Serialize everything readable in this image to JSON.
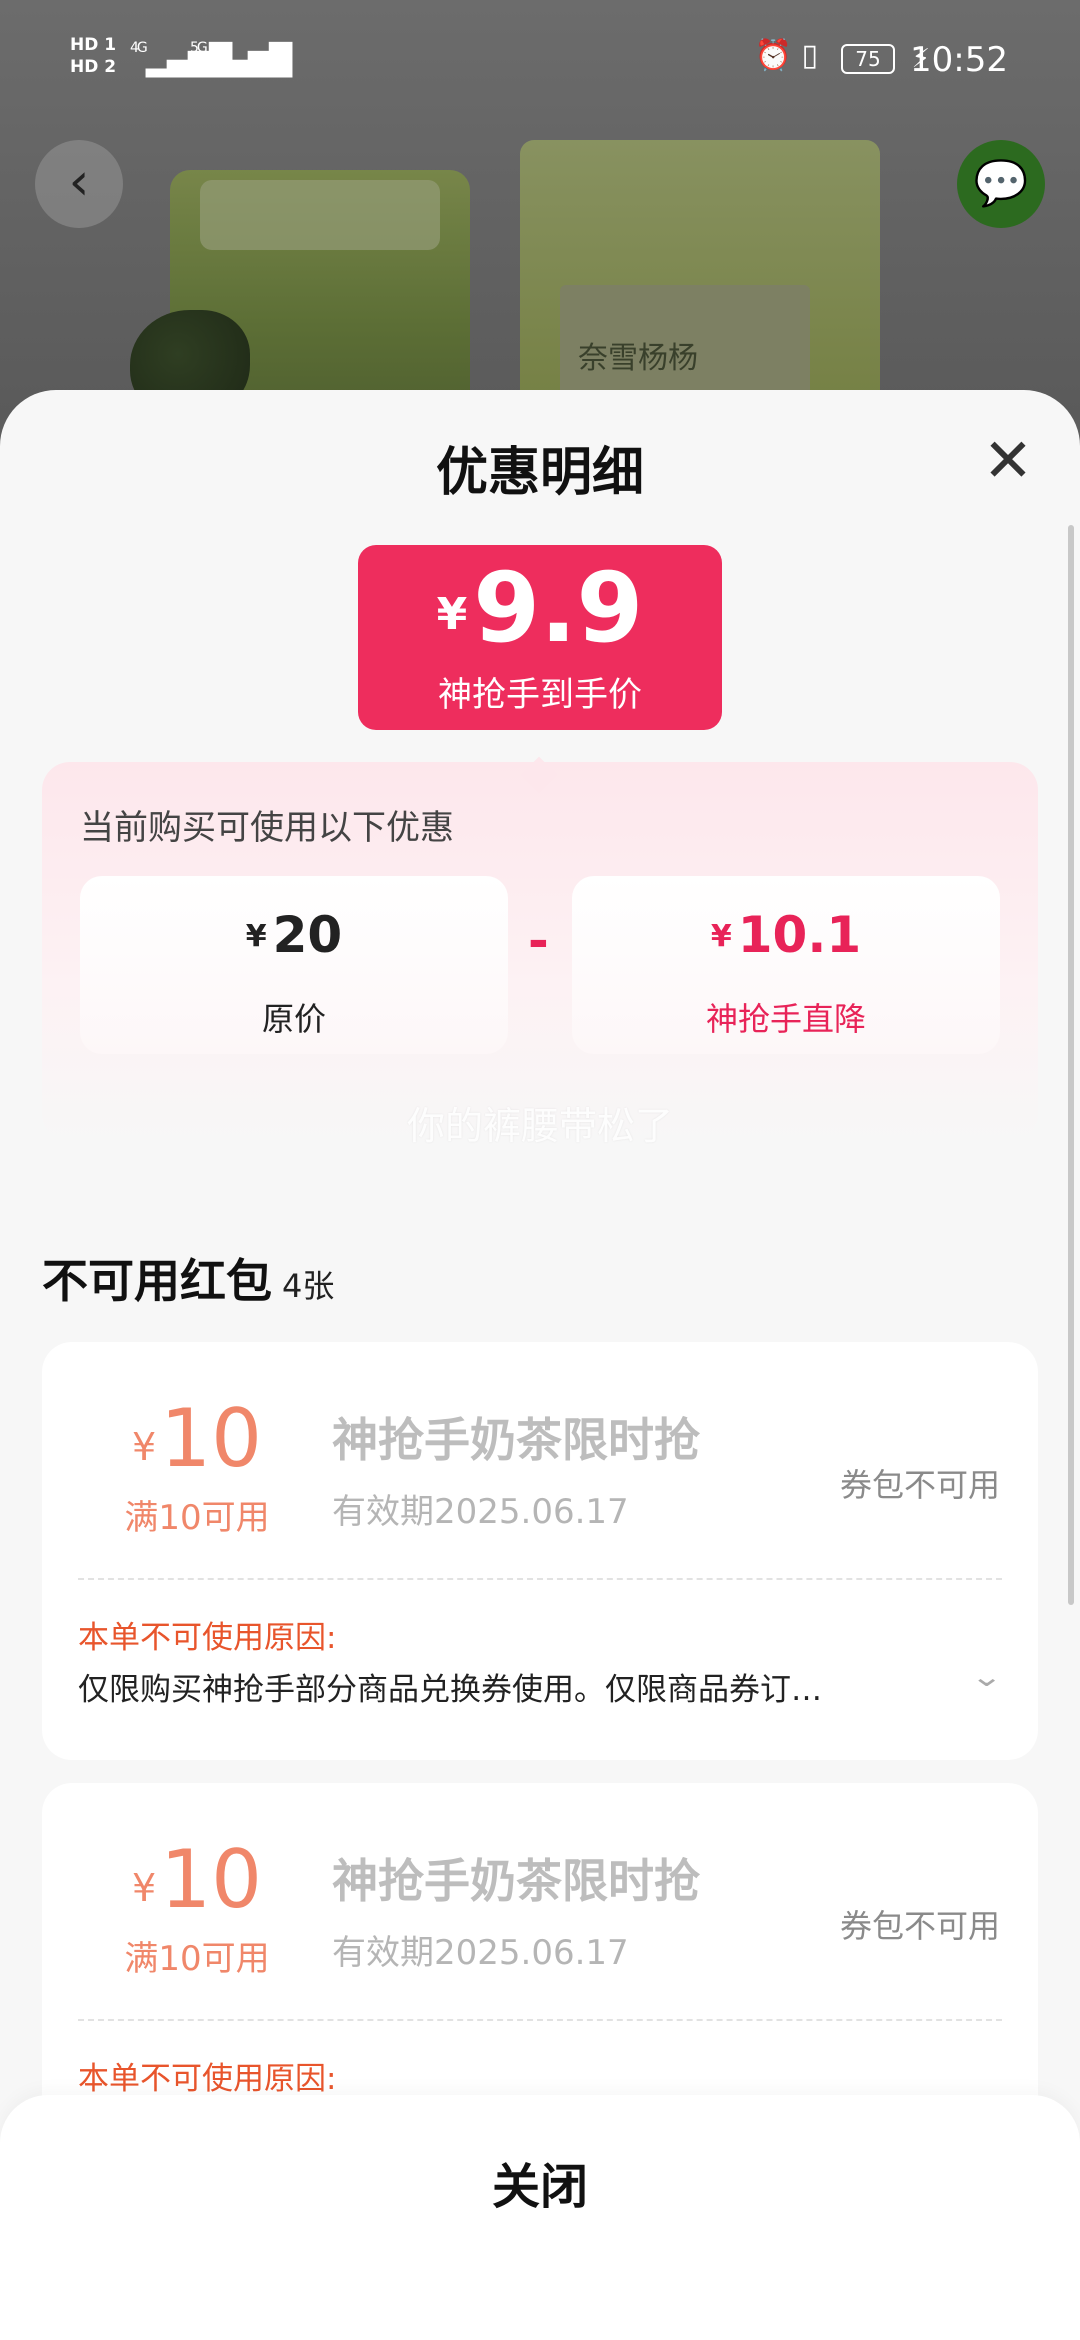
{
  "status_bar": {
    "sim1": "HD 1",
    "sim2": "HD 2",
    "net1": "4G",
    "net2": "5G",
    "battery": "75",
    "time": "10:52"
  },
  "background": {
    "product_label": "奈雪杨杨"
  },
  "sheet": {
    "title": "优惠明细",
    "final_price": {
      "currency": "¥",
      "value": "9.9",
      "label": "神抢手到手价"
    },
    "discount": {
      "header": "当前购买可使用以下优惠",
      "original": {
        "currency": "¥",
        "value": "20",
        "label": "原价"
      },
      "operator": "-",
      "cut": {
        "currency": "¥",
        "value": "10.1",
        "label": "神抢手直降"
      }
    },
    "watermark": "你的裤腰带松了",
    "unavailable": {
      "title": "不可用红包",
      "count": "4张",
      "coupons": [
        {
          "currency": "¥",
          "amount": "10",
          "condition": "满10可用",
          "name": "神抢手奶茶限时抢",
          "expiry": "有效期2025.06.17",
          "state": "券包不可用",
          "reason_header": "本单不可使用原因:",
          "reason": "仅限购买神抢手部分商品兑换券使用。仅限商品券订…"
        },
        {
          "currency": "¥",
          "amount": "10",
          "condition": "满10可用",
          "name": "神抢手奶茶限时抢",
          "expiry": "有效期2025.06.17",
          "state": "券包不可用",
          "reason_header": "本单不可使用原因:",
          "reason": ""
        }
      ]
    },
    "close_button": "关闭"
  }
}
